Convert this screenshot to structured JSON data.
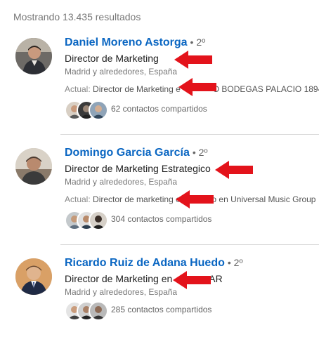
{
  "results_count": "Mostrando 13.435 resultados",
  "results": [
    {
      "name": "Daniel Moreno Astorga",
      "degree": "• 2º",
      "headline": "Director de Marketing",
      "location": "Madrid y alrededores, España",
      "current_label": "Actual:",
      "current_visible_left": "Director de Marketing e",
      "current_visible_right": "O BODEGAS PALACIO 1894",
      "shared_contacts": "62 contactos compartidos"
    },
    {
      "name": "Domingo Garcia García",
      "degree": "• 2º",
      "headline": "Director de Marketing Estrategico",
      "location": "Madrid y alrededores, España",
      "current_label": "Actual:",
      "current_visible_left": "Director de marketing e",
      "current_visible_right": "ico en Universal Music Group",
      "shared_contacts": "304 contactos compartidos"
    },
    {
      "name": "Ricardo Ruiz de Adana Huedo",
      "degree": "• 2º",
      "headline_left": "Director de Marketing en",
      "headline_right": "AR",
      "location": "Madrid y alrededores, España",
      "shared_contacts": "285 contactos compartidos"
    }
  ],
  "colors": {
    "name_link": "#0a66c2",
    "annotation_arrow": "#e3131b"
  }
}
